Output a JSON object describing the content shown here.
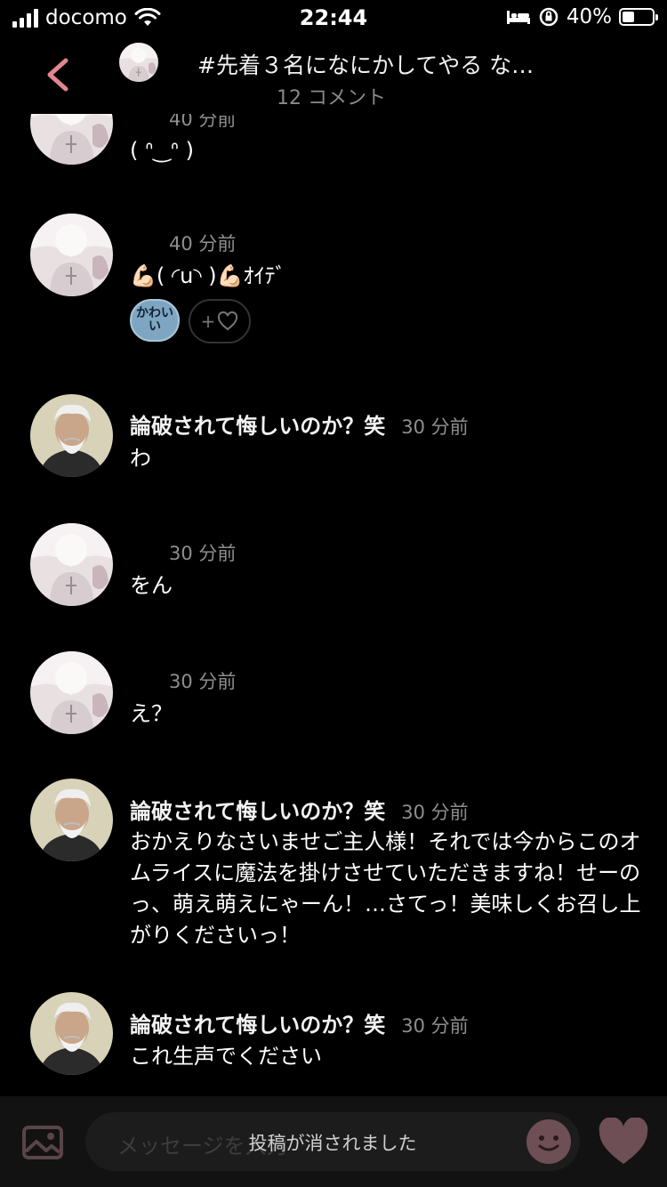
{
  "status_bar": {
    "carrier": "docomo",
    "time": "22:44",
    "battery_percent": "40%",
    "battery_level": 0.4
  },
  "header": {
    "title": "#先着３名になにかしてやる な…",
    "subtitle": "12 コメント"
  },
  "comments": [
    {
      "username": "",
      "timestamp": "40 分前",
      "body": "( ᐢ‿ᐢ )",
      "avatar": "girl-avatar"
    },
    {
      "username": "",
      "timestamp": "40 分前",
      "body": "💪🏻( ◜u◝ )💪🏻ｵｲﾃﾞ",
      "avatar": "girl-avatar",
      "reactions": {
        "chip_label": "かわいい",
        "add_label": "+"
      }
    },
    {
      "username": "論破されて悔しいのか？笑",
      "timestamp": "30 分前",
      "body": "わ",
      "avatar": "bearded-man-avatar"
    },
    {
      "username": "",
      "timestamp": "30 分前",
      "body": "をん",
      "avatar": "girl-avatar"
    },
    {
      "username": "",
      "timestamp": "30 分前",
      "body": "え？",
      "avatar": "girl-avatar"
    },
    {
      "username": "論破されて悔しいのか？笑",
      "timestamp": "30 分前",
      "body": "おかえりなさいませご主人様！それでは今からこのオムライスに魔法を掛けさせていただきますね！せーのっ、萌え萌えにゃーん！…さてっ！美味しくお召し上がりくださいっ！",
      "avatar": "bearded-man-avatar"
    },
    {
      "username": "論破されて悔しいのか？笑",
      "timestamp": "30 分前",
      "body": "これ生声でください",
      "avatar": "bearded-man-avatar"
    }
  ],
  "bottom_bar": {
    "placeholder": "メッセージを入力",
    "toast": "投稿が消されました"
  },
  "colors": {
    "accent_pink": "#e0878f",
    "heart_dark": "#6e4f56",
    "background": "#000000"
  }
}
